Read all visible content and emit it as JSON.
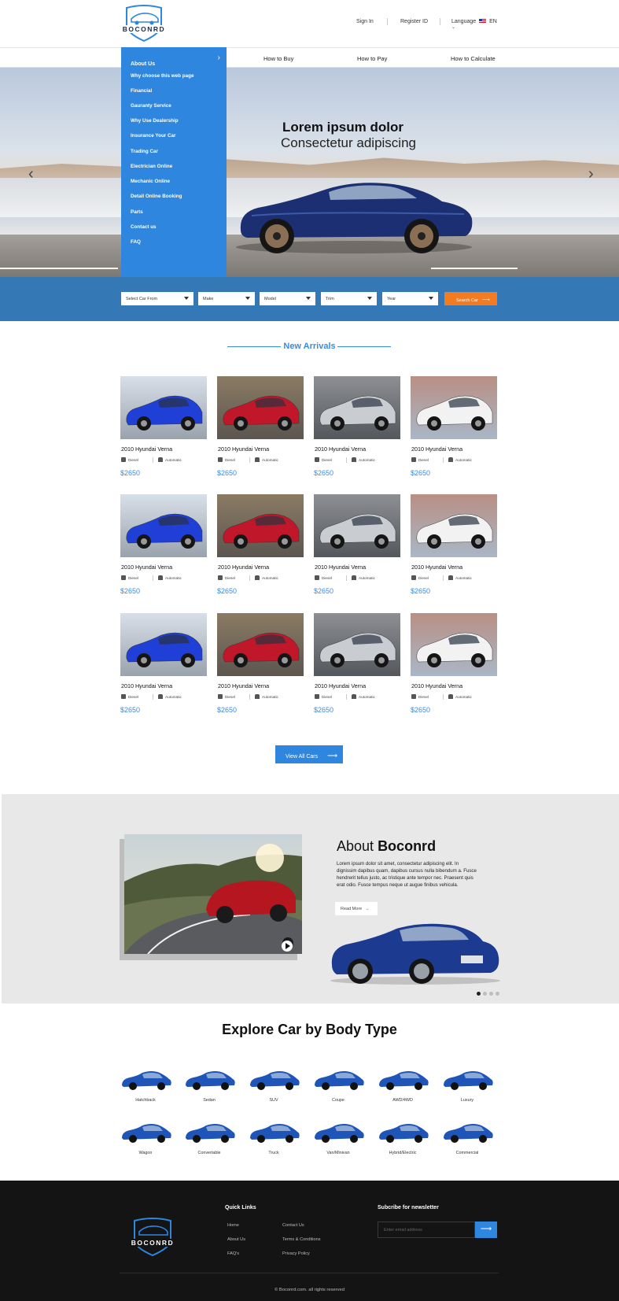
{
  "brand": {
    "name": "BOCONRD"
  },
  "topbar": {
    "sign_in": "Sign In",
    "register": "Register ID",
    "language_label": "Language",
    "language_value": "EN"
  },
  "nav": {
    "items": [
      "About Us",
      "How to Buy",
      "How to Pay",
      "How to Calculate"
    ]
  },
  "dropdown": {
    "items": [
      "Why choose this web page",
      "Financial",
      "Gauranty Service",
      "Why Use Dealership",
      "Insurance Your Car",
      "Trading Car",
      "Electrician Online",
      "Mechanic Online",
      "Detail Online Booking",
      "Parts",
      "Contact us",
      "FAQ"
    ]
  },
  "hero": {
    "title": "Lorem ipsum dolor",
    "subtitle": "Consectetur adipiscing",
    "prev": "‹",
    "next": "›"
  },
  "search": {
    "fields": [
      "Select Car From",
      "Make",
      "Model",
      "Trim",
      "Year"
    ],
    "button": "Search Car"
  },
  "arrivals": {
    "title": "New Arrivals",
    "cars": [
      {
        "name": "2010 Hyundai Verna",
        "fuel": "Diesel",
        "trans": "Automatic",
        "price": "$2650",
        "color": "#1f3fd6"
      },
      {
        "name": "2010 Hyundai Verna",
        "fuel": "Diesel",
        "trans": "Automatic",
        "price": "$2650",
        "color": "#c0182a"
      },
      {
        "name": "2010 Hyundai Verna",
        "fuel": "Diesel",
        "trans": "Automatic",
        "price": "$2650",
        "color": "#c9ccd1"
      },
      {
        "name": "2010 Hyundai Verna",
        "fuel": "Diesel",
        "trans": "Automatic",
        "price": "$2650",
        "color": "#f2f2f2"
      },
      {
        "name": "2010 Hyundai Verna",
        "fuel": "Diesel",
        "trans": "Automatic",
        "price": "$2650",
        "color": "#1f3fd6"
      },
      {
        "name": "2010 Hyundai Verna",
        "fuel": "Diesel",
        "trans": "Automatic",
        "price": "$2650",
        "color": "#c0182a"
      },
      {
        "name": "2010 Hyundai Verna",
        "fuel": "Diesel",
        "trans": "Automatic",
        "price": "$2650",
        "color": "#c9ccd1"
      },
      {
        "name": "2010 Hyundai Verna",
        "fuel": "Diesel",
        "trans": "Automatic",
        "price": "$2650",
        "color": "#f2f2f2"
      },
      {
        "name": "2010 Hyundai Verna",
        "fuel": "Diesel",
        "trans": "Automatic",
        "price": "$2650",
        "color": "#1f3fd6"
      },
      {
        "name": "2010 Hyundai Verna",
        "fuel": "Diesel",
        "trans": "Automatic",
        "price": "$2650",
        "color": "#c0182a"
      },
      {
        "name": "2010 Hyundai Verna",
        "fuel": "Diesel",
        "trans": "Automatic",
        "price": "$2650",
        "color": "#c9ccd1"
      },
      {
        "name": "2010 Hyundai Verna",
        "fuel": "Diesel",
        "trans": "Automatic",
        "price": "$2650",
        "color": "#f2f2f2"
      }
    ],
    "view_all": "View All Cars"
  },
  "about": {
    "title_light": "About",
    "title_bold": "Boconrd",
    "text": "Lorem ipsum dolor sit amet, consectetur adipiscing elit. In dignissim dapibus quam, dapibus cursus nulla bibendum a. Fusce hendrerit tellus justo, ac tristique ante tempor nec. Praesent quis erat odio. Fusce tempus neque ut augue finibus vehicula.",
    "read_more": "Read More"
  },
  "explore": {
    "title": "Explore Car by Body Type",
    "types": [
      "Hatchback",
      "Sedan",
      "SUV",
      "Coupe",
      "AWD/4WD",
      "Luxury",
      "Wagon",
      "Convertable",
      "Truck",
      "Van/Minivan",
      "Hybrid/Electric",
      "Commercial"
    ]
  },
  "footer": {
    "quick_links_title": "Quick Links",
    "links_col1": [
      "Home",
      "About Us",
      "FAQ's"
    ],
    "links_col2": [
      "Contact Us",
      "Terms & Conditions",
      "Privacy Policy"
    ],
    "newsletter_title": "Subcribe for newsletter",
    "email_placeholder": "Enter email address",
    "copyright": "© Boconrd.com. all rights reserved"
  },
  "colors": {
    "accent": "#2e86de",
    "search_band": "#3478b6",
    "search_button": "#f47b20",
    "footer": "#141414"
  }
}
